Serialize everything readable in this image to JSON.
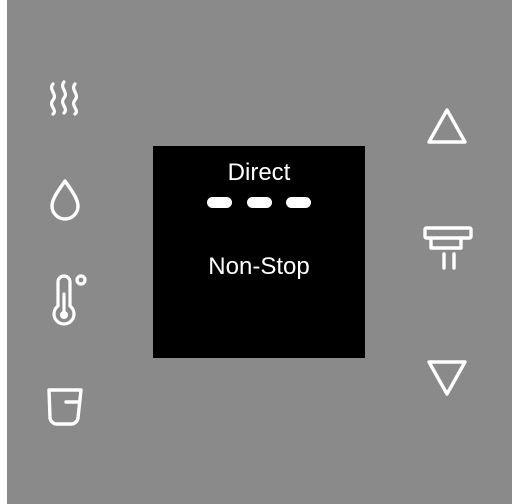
{
  "display": {
    "mode_label": "Direct",
    "dispense_label": "Non-Stop",
    "level_indicator_count": 3
  },
  "left_buttons": [
    {
      "icon": "hot-water-icon"
    },
    {
      "icon": "water-drop-icon"
    },
    {
      "icon": "thermometer-icon"
    },
    {
      "icon": "cup-icon"
    }
  ],
  "right_buttons": [
    {
      "icon": "arrow-up-icon"
    },
    {
      "icon": "dispenser-nozzle-icon"
    },
    {
      "icon": "arrow-down-icon"
    }
  ],
  "colors": {
    "panel_background": "#8a8a8a",
    "display_background": "#000000",
    "icon_color": "#ffffff"
  }
}
